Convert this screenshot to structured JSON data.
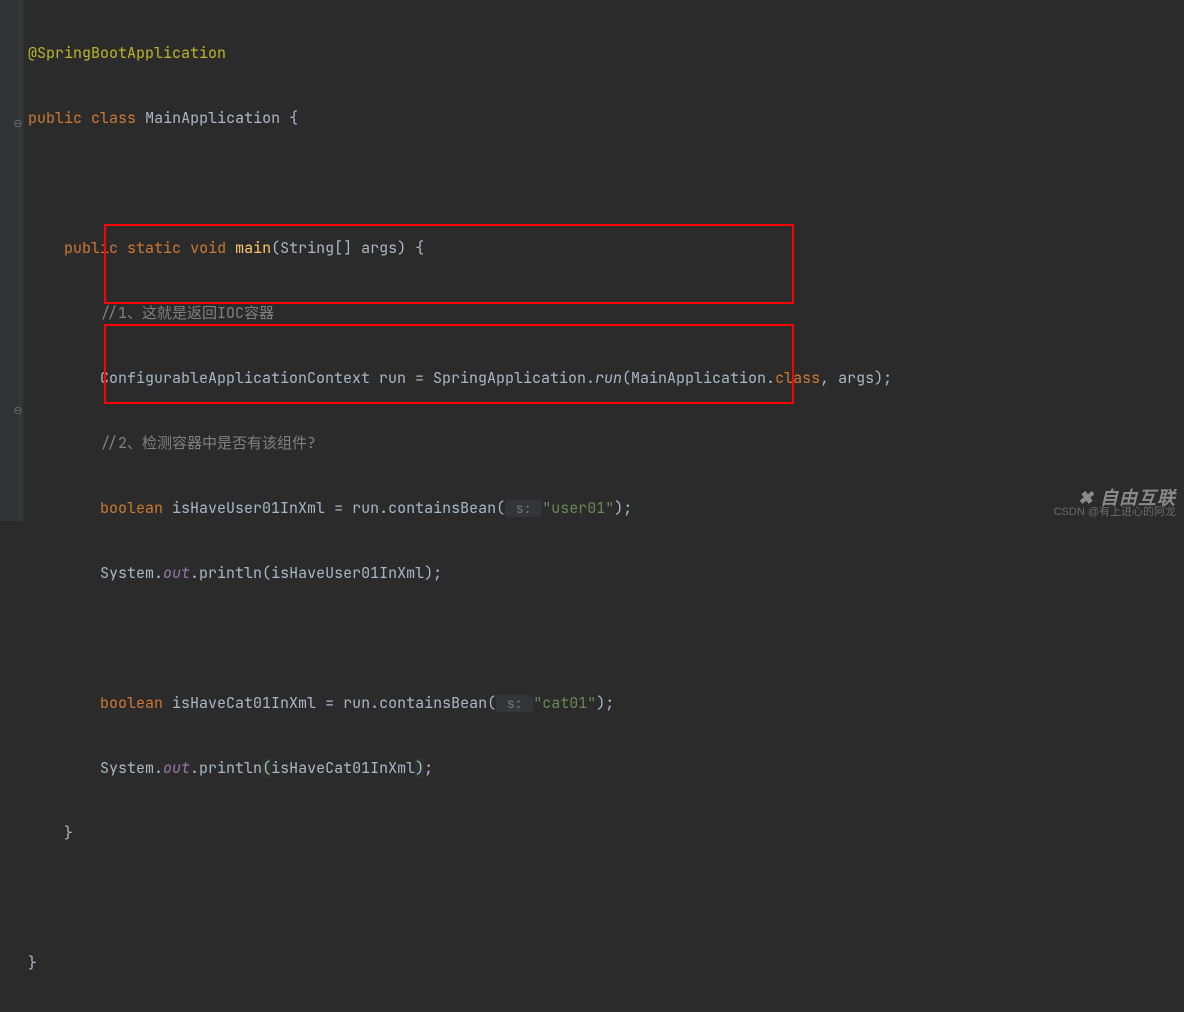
{
  "code": {
    "annotation": "@SpringBootApplication",
    "decl_public": "public",
    "decl_class": "class",
    "class_name": "MainApplication",
    "brace_open": " {",
    "method_public": "public",
    "method_static": "static",
    "method_void": "void",
    "method_name": "main",
    "method_params": "(String[] args) {",
    "comment1": "//1、这就是返回IOC容器",
    "line_cfg_type": "ConfigurableApplicationContext run = SpringApplication.",
    "run_call": "run",
    "run_args_open": "(MainApplication.",
    "class_kw": "class",
    "run_args_close": ", args);",
    "comment2": "//2、检测容器中是否有该组件?",
    "bool_kw": "boolean",
    "var_user": "isHaveUser01InXml",
    "assign_run_contains": " = run.containsBean(",
    "hint_s": " s: ",
    "str_user": "\"user01\"",
    "paren_semi": ");",
    "sys": "System.",
    "out": "out",
    "println_open": ".println(",
    "println_user_arg": "isHaveUser01InXml",
    "println_close": ");",
    "var_cat": "isHaveCat01InXml",
    "str_cat": "\"cat01\"",
    "println_cat_arg": "isHaveCat01InXml",
    "method_close": "}",
    "class_close": "}"
  },
  "watermark": {
    "brand": "✖ 自由互联",
    "author": "CSDN @有上进心的阿龙"
  }
}
